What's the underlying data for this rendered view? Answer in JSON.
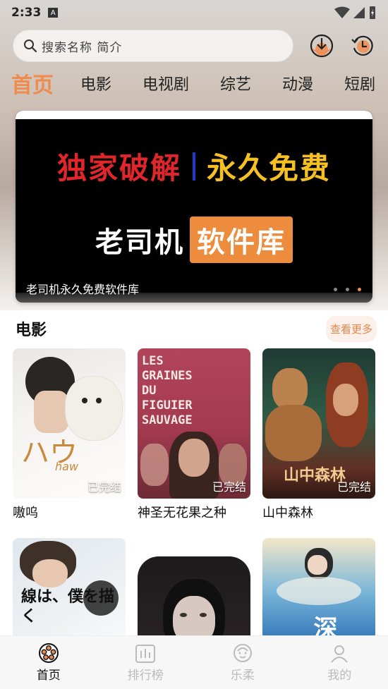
{
  "status_bar": {
    "time": "2:33",
    "a_icon_label": "A"
  },
  "search": {
    "placeholder": "搜索名称 简介"
  },
  "tabs": [
    {
      "label": "首页",
      "active": true
    },
    {
      "label": "电影"
    },
    {
      "label": "电视剧"
    },
    {
      "label": "综艺"
    },
    {
      "label": "动漫"
    },
    {
      "label": "短剧"
    }
  ],
  "banner": {
    "line1_left": "独家破解",
    "line1_right": "永久免费",
    "brand_white": "老司机",
    "brand_orange": "软件库",
    "caption": "老司机永久免费软件库",
    "dots_count": 3,
    "active_dot": 3
  },
  "section": {
    "title": "电影",
    "more": "查看更多"
  },
  "movies": [
    {
      "title": "嗷呜",
      "status": "已完结",
      "poster_text": "ハウ",
      "poster_sub": "haw"
    },
    {
      "title": "神圣无花果之种",
      "status": "已完结",
      "poster_text": "LES GRAINES DU FIGUIER SAUVAGE"
    },
    {
      "title": "山中森林",
      "status": "已完结",
      "poster_text": "山中森林"
    },
    {
      "title": "",
      "status": "",
      "poster_text": "線は、僕を描く"
    },
    {
      "title": "",
      "status": ""
    },
    {
      "title": "",
      "status": "",
      "poster_text": "深海"
    }
  ],
  "bottom_nav": [
    {
      "label": "首页",
      "icon": "film-reel-icon",
      "active": true
    },
    {
      "label": "排行榜",
      "icon": "chart-icon"
    },
    {
      "label": "乐柔",
      "icon": "face-icon"
    },
    {
      "label": "我的",
      "icon": "profile-icon"
    }
  ]
}
